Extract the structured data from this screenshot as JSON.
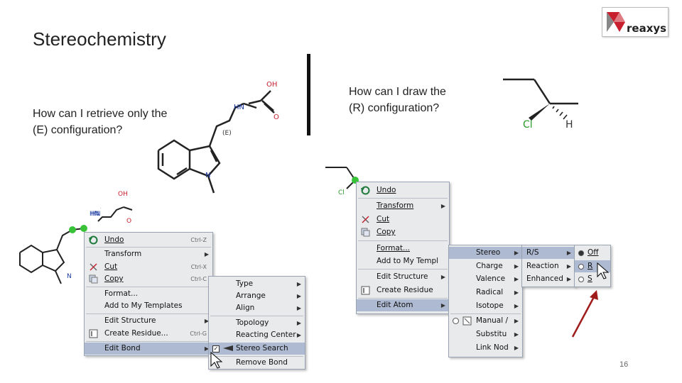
{
  "slide": {
    "title": "Stereochemistry",
    "page_number": "16"
  },
  "logo": {
    "name": "reaxys",
    "icon": "reaxys-logo-icon",
    "colors": {
      "red": "#c8202f",
      "gray": "#888888"
    }
  },
  "left": {
    "question": [
      "How can I retrieve only the",
      "(E) configuration?"
    ],
    "structure_labels": {
      "oh": "OH",
      "nh": "HN",
      "o": "O",
      "n": "N",
      "e": "(E)"
    },
    "small_labels": {
      "oh": "OH",
      "nh": "HN",
      "o": "O",
      "n": "N"
    },
    "context_menu": [
      {
        "label": "Undo",
        "shortcut": "Ctrl-Z",
        "icon": "undo-icon"
      },
      {
        "label": "Transform",
        "submenu": true
      },
      {
        "label": "Cut",
        "shortcut": "Ctrl-X",
        "icon": "scissors-icon"
      },
      {
        "label": "Copy",
        "shortcut": "Ctrl-C",
        "icon": "copy-icon"
      },
      {
        "label": "Format..."
      },
      {
        "label": "Add to My Templates"
      },
      {
        "label": "Edit Structure",
        "submenu": true
      },
      {
        "label": "Create Residue...",
        "shortcut": "Ctrl-G",
        "icon": "residue-icon"
      },
      {
        "label": "Edit Bond",
        "submenu": true,
        "selected": true
      }
    ],
    "bond_submenu": [
      {
        "label": "Type",
        "submenu": true
      },
      {
        "label": "Arrange",
        "submenu": true
      },
      {
        "label": "Align",
        "submenu": true
      },
      {
        "label": "Topology",
        "submenu": true
      },
      {
        "label": "Reacting Center",
        "submenu": true
      },
      {
        "label": "Stereo Search",
        "checked": true,
        "selected": true,
        "icon": "stereo-bond-icon"
      },
      {
        "label": "Remove Bond"
      }
    ]
  },
  "right": {
    "question": [
      "How can I draw the",
      "(R) configuration?"
    ],
    "structure_labels": {
      "cl": "Cl",
      "h": "H"
    },
    "small_labels": {
      "cl": "Cl"
    },
    "context_menu": [
      {
        "label": "Undo",
        "icon": "undo-icon"
      },
      {
        "label": "Transform",
        "submenu": true
      },
      {
        "label": "Cut",
        "icon": "scissors-icon"
      },
      {
        "label": "Copy",
        "icon": "copy-icon"
      },
      {
        "label": "Format..."
      },
      {
        "label": "Add to My Templ"
      },
      {
        "label": "Edit Structure",
        "submenu": true
      },
      {
        "label": "Create Residue",
        "icon": "residue-icon"
      },
      {
        "label": "Edit Atom",
        "submenu": true,
        "selected": true
      }
    ],
    "atom_submenu": [
      {
        "label": "Stereo",
        "submenu": true,
        "selected": true
      },
      {
        "label": "Charge",
        "submenu": true
      },
      {
        "label": "Valence",
        "submenu": true
      },
      {
        "label": "Radical",
        "submenu": true
      },
      {
        "label": "Isotope",
        "submenu": true
      },
      {
        "label": "Manual /",
        "radio": true,
        "icon": "manual-map-icon"
      },
      {
        "label": "Substitu",
        "submenu": true
      },
      {
        "label": "Link Nod",
        "submenu": true
      }
    ],
    "stereo_submenu": [
      {
        "label": "R/S",
        "submenu": true,
        "selected": true
      },
      {
        "label": "Reaction",
        "submenu": true
      },
      {
        "label": "Enhanced",
        "submenu": true
      }
    ],
    "rs_submenu": [
      {
        "label": "Off",
        "checked": true
      },
      {
        "label": "R",
        "checked": false,
        "selected": true
      },
      {
        "label": "S",
        "checked": false
      }
    ],
    "arrow_color": "#a01c1c"
  }
}
